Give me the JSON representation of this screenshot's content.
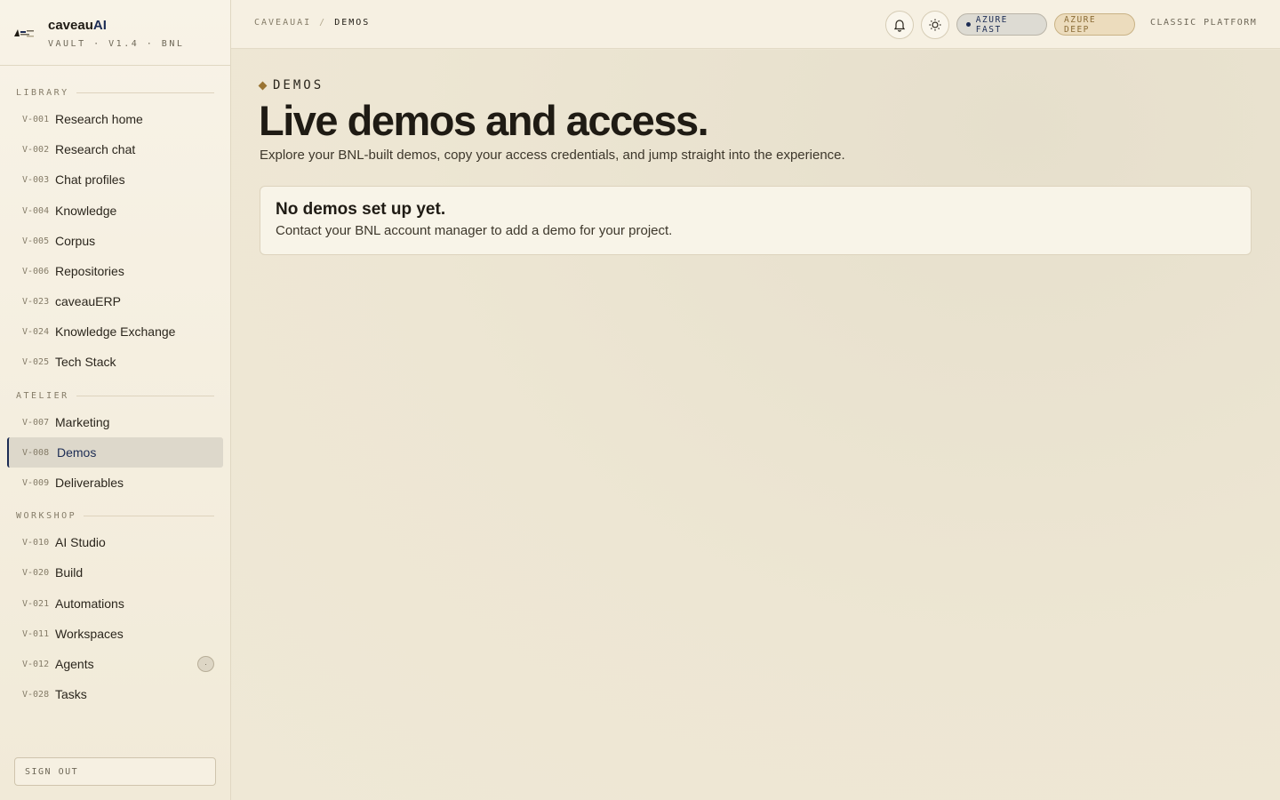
{
  "brand": {
    "name_prefix": "caveau",
    "name_suffix": "AI",
    "subtitle": "VAULT · V1.4 · BNL"
  },
  "sidebar": {
    "sections": [
      {
        "label": "LIBRARY",
        "items": [
          {
            "code": "V-001",
            "label": "Research home"
          },
          {
            "code": "V-002",
            "label": "Research chat"
          },
          {
            "code": "V-003",
            "label": "Chat profiles"
          },
          {
            "code": "V-004",
            "label": "Knowledge"
          },
          {
            "code": "V-005",
            "label": "Corpus"
          },
          {
            "code": "V-006",
            "label": "Repositories"
          },
          {
            "code": "V-023",
            "label": "caveauERP"
          },
          {
            "code": "V-024",
            "label": "Knowledge Exchange"
          },
          {
            "code": "V-025",
            "label": "Tech Stack"
          }
        ]
      },
      {
        "label": "ATELIER",
        "items": [
          {
            "code": "V-007",
            "label": "Marketing"
          },
          {
            "code": "V-008",
            "label": "Demos",
            "active": true
          },
          {
            "code": "V-009",
            "label": "Deliverables"
          }
        ]
      },
      {
        "label": "WORKSHOP",
        "items": [
          {
            "code": "V-010",
            "label": "AI Studio"
          },
          {
            "code": "V-020",
            "label": "Build"
          },
          {
            "code": "V-021",
            "label": "Automations"
          },
          {
            "code": "V-011",
            "label": "Workspaces"
          },
          {
            "code": "V-012",
            "label": "Agents",
            "badge": "·"
          },
          {
            "code": "V-028",
            "label": "Tasks"
          }
        ]
      }
    ],
    "sign_out": "SIGN OUT"
  },
  "topbar": {
    "breadcrumb": {
      "root": "CAVEAUAI",
      "separator": "/",
      "current": "DEMOS"
    },
    "icons": {
      "notifications": "bell-icon",
      "theme": "sun-icon"
    },
    "azure_fast": "AZURE FAST",
    "azure_deep": "AZURE DEEP",
    "classic": "CLASSIC PLATFORM"
  },
  "main": {
    "eyebrow": "DEMOS",
    "title": "Live demos and access.",
    "subtitle": "Explore your BNL-built demos, copy your access credentials, and jump straight into the experience.",
    "empty": {
      "title": "No demos set up yet.",
      "text": "Contact your BNL account manager to add a demo for your project."
    }
  },
  "colors": {
    "accent_navy": "#1c2c54",
    "accent_gold": "#9a7433",
    "background": "#ede6d3",
    "sidebar_bg": "#f8f3e7"
  }
}
